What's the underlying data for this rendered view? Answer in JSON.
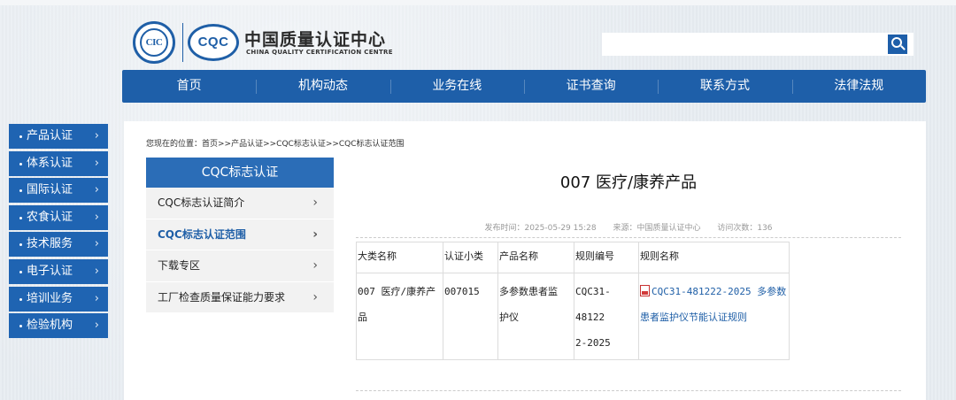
{
  "header": {
    "logo_left_text": "CIC",
    "logo_right_text": "CQC",
    "org_name_cn": "中国质量认证中心",
    "org_name_en": "CHINA QUALITY CERTIFICATION CENTRE",
    "search": {
      "value": "",
      "placeholder": ""
    }
  },
  "nav": [
    "首页",
    "机构动态",
    "业务在线",
    "证书查询",
    "联系方式",
    "法律法规"
  ],
  "sidebar": [
    "产品认证",
    "体系认证",
    "国际认证",
    "农食认证",
    "技术服务",
    "电子认证",
    "培训业务",
    "检验机构"
  ],
  "breadcrumb": "您现在的位置：首页>>产品认证>>CQC标志认证>>CQC标志认证范围",
  "submenu": {
    "title": "CQC标志认证",
    "items": [
      "CQC标志认证简介",
      "CQC标志认证范围",
      "下载专区",
      "工厂检查质量保证能力要求"
    ],
    "active_index": 1
  },
  "article": {
    "title": "007 医疗/康养产品",
    "meta": {
      "published": "发布时间：2025-05-29 15:28",
      "source": "来源：中国质量认证中心",
      "visits": "访问次数：136"
    },
    "table": {
      "headers": [
        "大类名称",
        "认证小类",
        "产品名称",
        "规则编号",
        "规则名称"
      ],
      "rows": [
        {
          "category": [
            "007 医疗/康养产",
            "品"
          ],
          "subclass": "007015",
          "product": [
            "多参数患者监",
            "护仪"
          ],
          "rule_no": [
            "CQC31-48122",
            "2-2025"
          ],
          "rule_name": [
            "CQC31-481222-2025 多参数",
            "患者监护仪节能认证规则"
          ]
        }
      ]
    }
  },
  "colors": {
    "primary": "#1e5fa9",
    "sidebar": "#1f64b2",
    "submenu_head": "#2b6db7",
    "link": "#1f5fa7"
  },
  "icons": {
    "search": "search-icon",
    "pdf": "pdf-file-icon",
    "chevron": "chevron-right-icon"
  }
}
